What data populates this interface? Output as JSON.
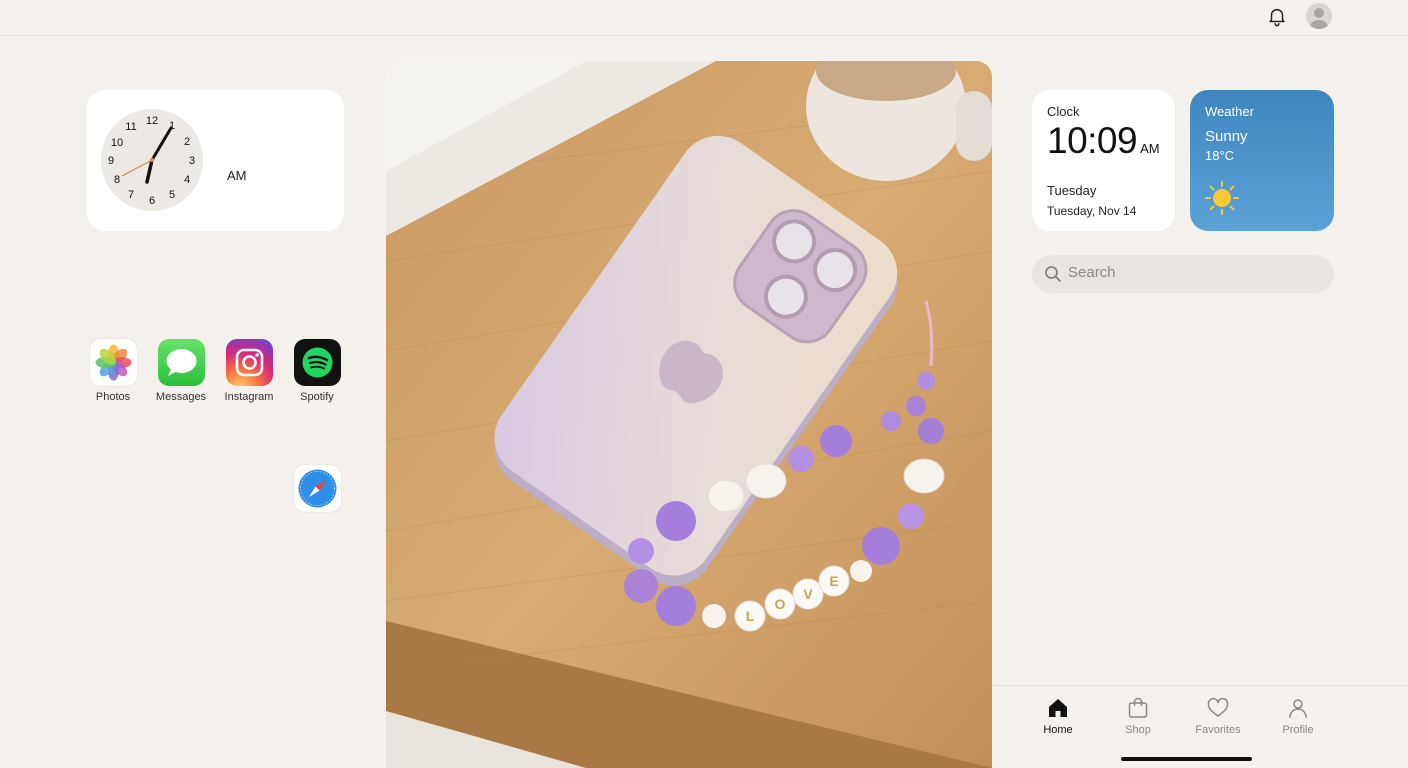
{
  "topbar": {
    "icons": [
      "bell-icon",
      "avatar"
    ]
  },
  "clock_widget": {
    "numbers": [
      "12",
      "1",
      "2",
      "3",
      "4",
      "5",
      "6",
      "7",
      "8",
      "9",
      "10",
      "11"
    ],
    "ampm": "AM"
  },
  "apps": [
    {
      "label": "Photos",
      "icon": "photos-icon"
    },
    {
      "label": "Messages",
      "icon": "messages-icon"
    },
    {
      "label": "Instagram",
      "icon": "instagram-icon"
    },
    {
      "label": "Spotify",
      "icon": "spotify-icon"
    }
  ],
  "dock_extra": {
    "icon": "safari-icon"
  },
  "photo": {
    "subject": "phone-with-bead-strap",
    "strap_text": "LOVE"
  },
  "digital_clock": {
    "title": "Clock",
    "time": "10:09",
    "ampm": "AM",
    "day": "Tuesday",
    "date": "Tuesday, Nov 14"
  },
  "weather": {
    "title": "Weather",
    "condition": "Sunny",
    "temp": "18°C",
    "icon": "sun-icon"
  },
  "search": {
    "placeholder": "Search"
  },
  "bottom_nav": {
    "items": [
      {
        "label": "Home",
        "icon": "home-icon",
        "active": true
      },
      {
        "label": "Shop",
        "icon": "shop-icon",
        "active": false
      },
      {
        "label": "Favorites",
        "icon": "heart-icon",
        "active": false
      },
      {
        "label": "Profile",
        "icon": "profile-icon",
        "active": false
      }
    ]
  },
  "colors": {
    "background": "#f4f1ec",
    "weather_top": "#3f86bf",
    "weather_bottom": "#5aa2d6",
    "spotify_green": "#1ed760"
  }
}
